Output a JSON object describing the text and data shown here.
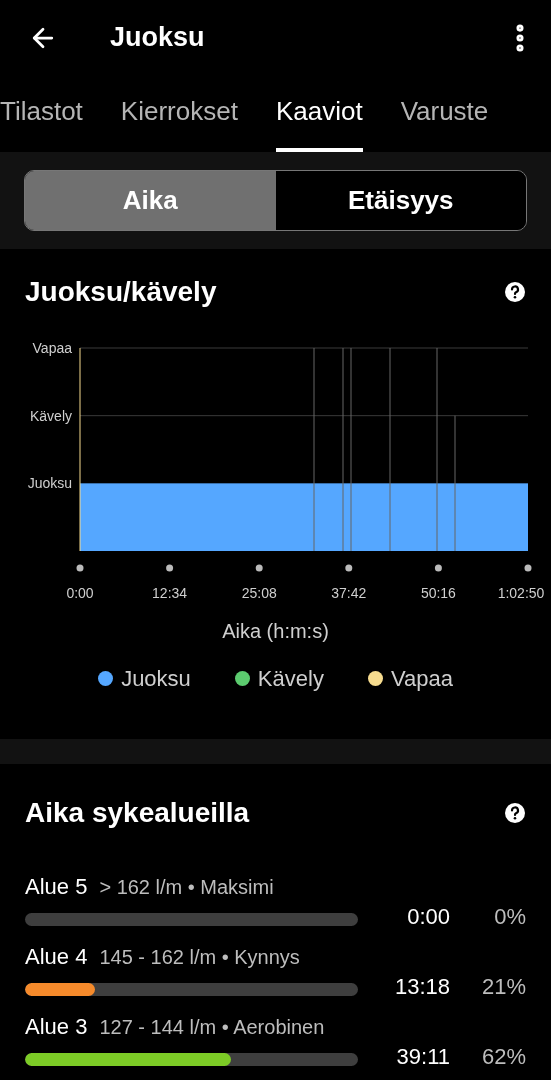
{
  "header": {
    "title": "Juoksu"
  },
  "tabs": [
    {
      "label": "Tilastot",
      "selected": false
    },
    {
      "label": "Kierrokset",
      "selected": false
    },
    {
      "label": "Kaaviot",
      "selected": true
    },
    {
      "label": "Varuste",
      "selected": false
    }
  ],
  "segments": [
    {
      "label": "Aika",
      "selected": true
    },
    {
      "label": "Etäisyys",
      "selected": false
    }
  ],
  "activity_chart": {
    "title": "Juoksu/kävely",
    "y_labels": [
      "Vapaa",
      "Kävely",
      "Juoksu"
    ],
    "x_labels": [
      "0:00",
      "12:34",
      "25:08",
      "37:42",
      "50:16",
      "1:02:50"
    ],
    "axis_title": "Aika (h:m:s)",
    "legend": [
      {
        "name": "Juoksu",
        "color": "#55a7ff"
      },
      {
        "name": "Kävely",
        "color": "#5ccb6f"
      },
      {
        "name": "Vapaa",
        "color": "#f7dc8f"
      }
    ]
  },
  "zones": {
    "title": "Aika sykealueilla",
    "items": [
      {
        "name": "Alue 5",
        "range": "> 162 l/m • Maksimi",
        "time": "0:00",
        "percent": "0%"
      },
      {
        "name": "Alue 4",
        "range": "145 - 162 l/m • Kynnys",
        "level": 0.21,
        "color": "#f58a2b",
        "time": "13:18",
        "percent": "21%"
      },
      {
        "name": "Alue 3",
        "range": "127 - 144 l/m • Aerobinen",
        "level": 0.62,
        "color": "#7ccb26",
        "time": "39:11",
        "percent": "62%"
      }
    ]
  }
}
